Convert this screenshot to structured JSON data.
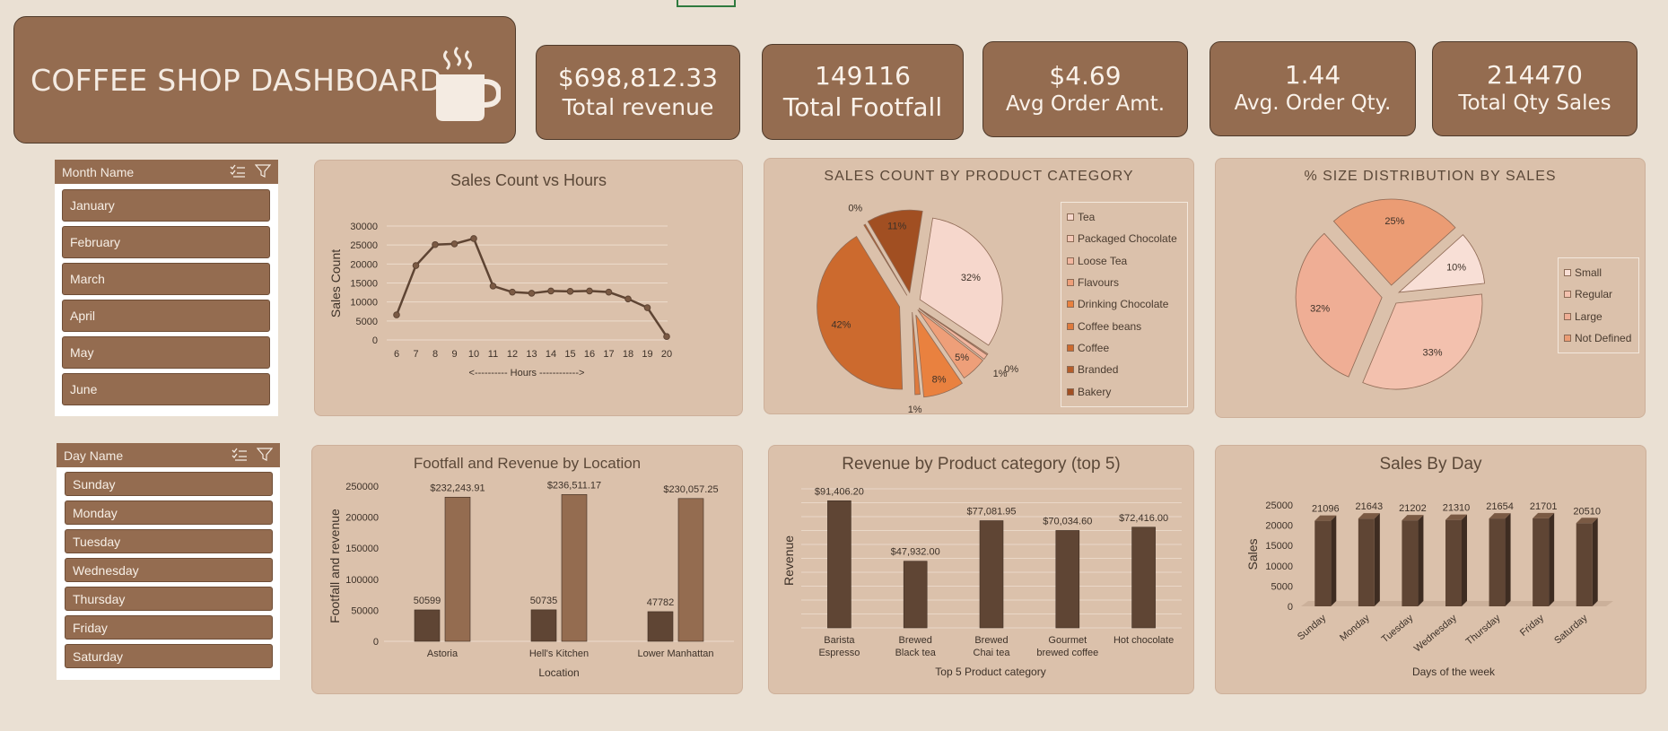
{
  "title": {
    "text": "COFFEE SHOP DASHBOARD",
    "icon": "coffee-cup-icon"
  },
  "kpis": [
    {
      "value": "$698,812.33",
      "label": "Total revenue"
    },
    {
      "value": "149116",
      "label": "Total Footfall"
    },
    {
      "value": "$4.69",
      "label": "Avg Order Amt."
    },
    {
      "value": "1.44",
      "label": "Avg. Order Qty."
    },
    {
      "value": "214470",
      "label": "Total Qty Sales"
    }
  ],
  "month_slicer": {
    "header": "Month Name",
    "items": [
      "January",
      "February",
      "March",
      "April",
      "May",
      "June"
    ]
  },
  "day_slicer": {
    "header": "Day Name",
    "items": [
      "Sunday",
      "Monday",
      "Tuesday",
      "Wednesday",
      "Thursday",
      "Friday",
      "Saturday"
    ]
  },
  "chart_data": [
    {
      "id": "hours",
      "type": "line",
      "title": "Sales Count vs Hours",
      "xlabel": "<----------   Hours ------------>",
      "ylabel": "Sales Count",
      "x": [
        6,
        7,
        8,
        9,
        10,
        11,
        12,
        13,
        14,
        15,
        16,
        17,
        18,
        19,
        20
      ],
      "values": [
        6600,
        19600,
        25100,
        25300,
        26700,
        14200,
        12600,
        12300,
        12900,
        12800,
        12900,
        12600,
        10800,
        8500,
        900
      ],
      "ylim": [
        0,
        30000
      ],
      "yticks": [
        0,
        5000,
        10000,
        15000,
        20000,
        25000,
        30000
      ],
      "grid": true,
      "color": "#5e4433"
    },
    {
      "id": "category",
      "type": "pie",
      "title": "SALES COUNT BY PRODUCT CATEGORY",
      "slices": [
        {
          "name": "Tea",
          "value": 32,
          "label": "32%",
          "color": "#f6d7cc"
        },
        {
          "name": "Packaged Chocolate",
          "value": 0.2,
          "label": "0%",
          "color": "#f4c7b6"
        },
        {
          "name": "Loose Tea",
          "value": 1,
          "label": "1%",
          "color": "#f2b69f"
        },
        {
          "name": "Flavours",
          "value": 5,
          "label": "5%",
          "color": "#ee9f79"
        },
        {
          "name": "Drinking Chocolate",
          "value": 8,
          "label": "8%",
          "color": "#e9813f"
        },
        {
          "name": "Coffee beans",
          "value": 1,
          "label": "1%",
          "color": "#de7a3d"
        },
        {
          "name": "Coffee",
          "value": 42,
          "label": "42%",
          "color": "#cc6a2e"
        },
        {
          "name": "Branded",
          "value": 0.3,
          "label": "0%",
          "color": "#b55d2a"
        },
        {
          "name": "Bakery",
          "value": 11,
          "label": "11%",
          "color": "#a14f22"
        }
      ],
      "legend": "right"
    },
    {
      "id": "size",
      "type": "pie",
      "title": "% SIZE DISTRIBUTION BY SALES",
      "slices": [
        {
          "name": "Small",
          "value": 10,
          "label": "10%",
          "color": "#f8dfd6"
        },
        {
          "name": "Regular",
          "value": 33,
          "label": "33%",
          "color": "#f3c1ae"
        },
        {
          "name": "Large",
          "value": 32,
          "label": "32%",
          "color": "#efae95"
        },
        {
          "name": "Not Defined",
          "value": 25,
          "label": "25%",
          "color": "#eb9c74"
        }
      ],
      "legend": "right"
    },
    {
      "id": "location",
      "type": "bar",
      "title": "Footfall and Revenue by Location",
      "xlabel": "Location",
      "ylabel": "Footfall and revenue",
      "categories": [
        "Astoria",
        "Hell's Kitchen",
        "Lower Manhattan"
      ],
      "series": [
        {
          "values": [
            50599,
            50735,
            47782
          ],
          "labels": [
            "50599",
            "50735",
            "47782"
          ],
          "color": "#5f4534"
        },
        {
          "values": [
            232243.91,
            236511.17,
            230057.25
          ],
          "labels": [
            "$232,243.91",
            "$236,511.17",
            "$230,057.25"
          ],
          "color": "#946c50"
        }
      ],
      "ylim": [
        0,
        250000
      ],
      "yticks": [
        0,
        50000,
        100000,
        150000,
        200000,
        250000
      ]
    },
    {
      "id": "top5",
      "type": "bar",
      "title": "Revenue by Product category (top 5)",
      "xlabel": "Top 5 Product category",
      "ylabel": "Revenue",
      "categories": [
        "Barista Espresso",
        "Brewed Black tea",
        "Brewed Chai tea",
        "Gourmet brewed coffee",
        "Hot chocolate"
      ],
      "values": [
        91406.2,
        47932.0,
        77081.95,
        70034.6,
        72416.0
      ],
      "labels": [
        "$91,406.20",
        "$47,932.00",
        "$77,081.95",
        "$70,034.60",
        "$72,416.00"
      ],
      "ylim": [
        0,
        100000
      ],
      "grid": true,
      "color": "#5f4534"
    },
    {
      "id": "day",
      "type": "bar",
      "title": "Sales By Day",
      "xlabel": "Days of the week",
      "ylabel": "Sales",
      "categories": [
        "Sunday",
        "Monday",
        "Tuesday",
        "Wednesday",
        "Thursday",
        "Friday",
        "Saturday"
      ],
      "values": [
        21096,
        21643,
        21202,
        21310,
        21654,
        21701,
        20510
      ],
      "ylim": [
        0,
        25000
      ],
      "yticks": [
        0,
        5000,
        10000,
        15000,
        20000,
        25000
      ],
      "color": "#5f4534"
    }
  ]
}
